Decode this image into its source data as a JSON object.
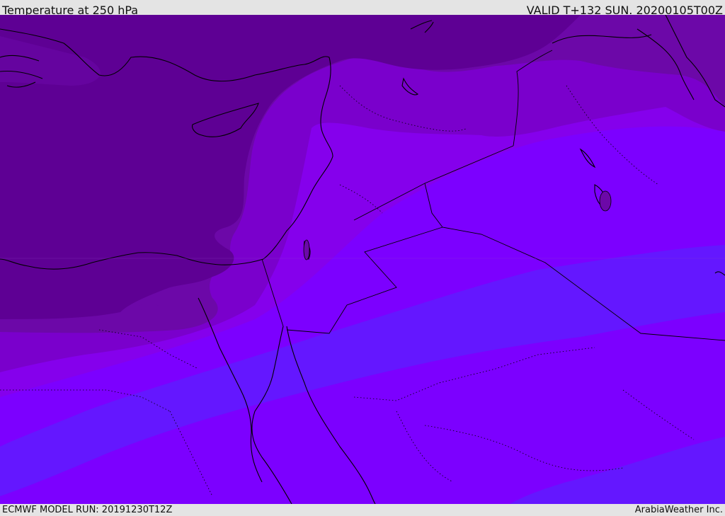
{
  "header": {
    "title": "Temperature at 250 hPa",
    "valid": "VALID T+132 SUN. 20200105T00Z"
  },
  "footer": {
    "model_run": "ECMWF MODEL RUN: 20191230T12Z",
    "credit": "ArabiaWeather Inc."
  },
  "map": {
    "field": "temperature",
    "level": "250 hPa",
    "region": "Eastern Mediterranean / Middle East",
    "colors": {
      "band_coldest": "#5e0094",
      "band_2": "#6c08a8",
      "band_3": "#7a00cc",
      "band_4": "#8500ec",
      "band_5": "#7c00ff",
      "band_warmest": "#6417ff",
      "border": "#000000",
      "coast": "#000000"
    }
  }
}
